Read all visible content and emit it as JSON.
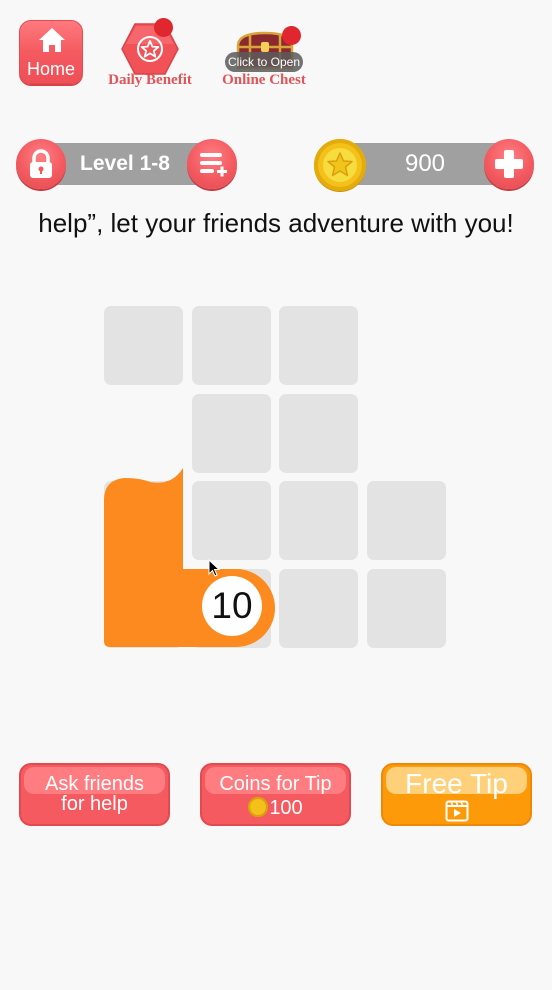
{
  "top_nav": {
    "home_label": "Home",
    "daily_benefit_label": "Daily Benefit",
    "online_chest_label": "Online Chest",
    "chest_overlay": "Click to Open"
  },
  "status_bar": {
    "level_label": "Level 1-8",
    "coins": "900"
  },
  "message": "help”, let your friends adventure with you!",
  "board": {
    "columns": 4,
    "rows": 4,
    "cells": [
      {
        "row": 0,
        "col": 0
      },
      {
        "row": 0,
        "col": 1
      },
      {
        "row": 0,
        "col": 2
      },
      {
        "row": 1,
        "col": 1
      },
      {
        "row": 1,
        "col": 2
      },
      {
        "row": 2,
        "col": 0
      },
      {
        "row": 2,
        "col": 1
      },
      {
        "row": 2,
        "col": 2
      },
      {
        "row": 2,
        "col": 3
      },
      {
        "row": 3,
        "col": 0
      },
      {
        "row": 3,
        "col": 1
      },
      {
        "row": 3,
        "col": 2
      },
      {
        "row": 3,
        "col": 3
      }
    ],
    "filled_path": [
      {
        "row": 2,
        "col": 0
      },
      {
        "row": 3,
        "col": 0
      },
      {
        "row": 3,
        "col": 1
      }
    ],
    "head_number": "10",
    "fill_color": "#fd8a1f"
  },
  "buttons": {
    "ask_friends_line1": "Ask friends",
    "ask_friends_line2": "for help",
    "coins_tip_line1": "Coins for Tip",
    "coins_tip_cost": "100",
    "free_tip_label": "Free Tip"
  },
  "colors": {
    "accent_red": "#f45a5f",
    "accent_orange": "#fc9a0a",
    "coin_gold": "#f3c11a",
    "tile_gray": "#e3e3e3"
  }
}
